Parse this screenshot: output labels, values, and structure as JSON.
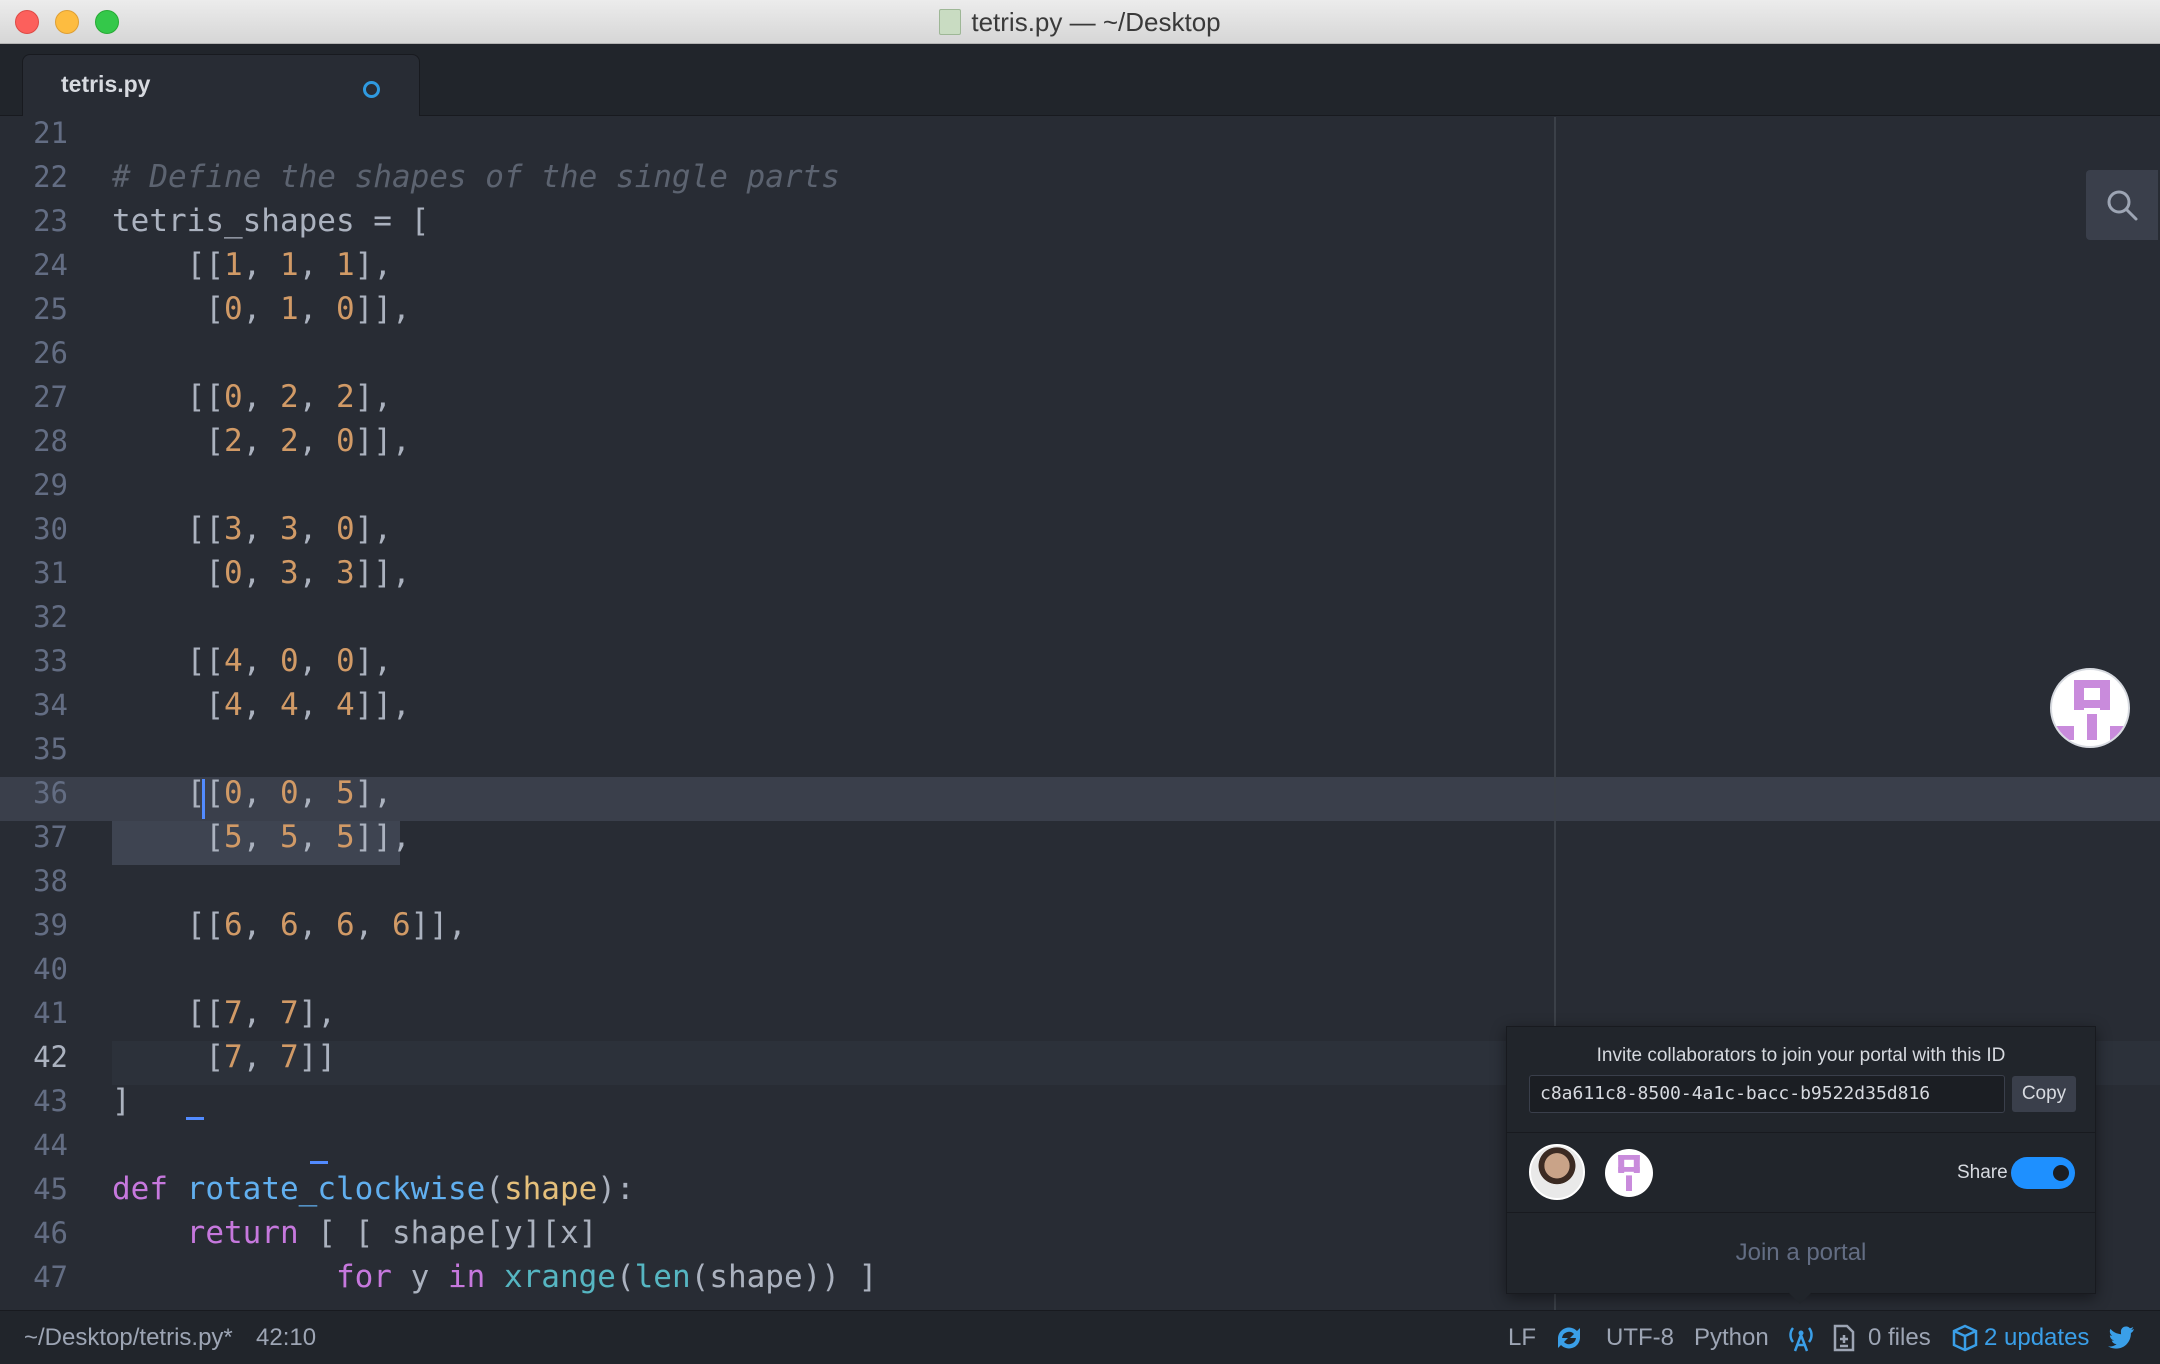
{
  "window": {
    "title": "tetris.py — ~/Desktop"
  },
  "tabs": [
    {
      "label": "tetris.py",
      "modified": true
    }
  ],
  "editor": {
    "first_line_number": 21,
    "current_line": 42,
    "lines": [
      {
        "n": "21",
        "code": ""
      },
      {
        "n": "22",
        "code": "# Define the shapes of the single parts"
      },
      {
        "n": "23",
        "code": "tetris_shapes = ["
      },
      {
        "n": "24",
        "code": "    [[1, 1, 1],"
      },
      {
        "n": "25",
        "code": "     [0, 1, 0]],"
      },
      {
        "n": "26",
        "code": ""
      },
      {
        "n": "27",
        "code": "    [[0, 2, 2],"
      },
      {
        "n": "28",
        "code": "     [2, 2, 0]],"
      },
      {
        "n": "29",
        "code": ""
      },
      {
        "n": "30",
        "code": "    [[3, 3, 0],"
      },
      {
        "n": "31",
        "code": "     [0, 3, 3]],"
      },
      {
        "n": "32",
        "code": ""
      },
      {
        "n": "33",
        "code": "    [[4, 0, 0],"
      },
      {
        "n": "34",
        "code": "     [4, 4, 4]],"
      },
      {
        "n": "35",
        "code": ""
      },
      {
        "n": "36",
        "code": "    [[0, 0, 5],"
      },
      {
        "n": "37",
        "code": "     [5, 5, 5]],"
      },
      {
        "n": "38",
        "code": ""
      },
      {
        "n": "39",
        "code": "    [[6, 6, 6, 6]],"
      },
      {
        "n": "40",
        "code": ""
      },
      {
        "n": "41",
        "code": "    [[7, 7],"
      },
      {
        "n": "42",
        "code": "     [7, 7]]"
      },
      {
        "n": "43",
        "code": "]"
      },
      {
        "n": "44",
        "code": ""
      },
      {
        "n": "45",
        "code": "def rotate_clockwise(shape):"
      },
      {
        "n": "46",
        "code": "    return [ [ shape[y][x]"
      },
      {
        "n": "47",
        "code": "            for y in xrange(len(shape)) ]"
      }
    ]
  },
  "portal_popover": {
    "invite_text": "Invite collaborators to join your portal with this ID",
    "portal_id": "c8a611c8-8500-4a1c-bacc-b9522d35d816",
    "copy_label": "Copy",
    "share_label": "Share",
    "share_enabled": true,
    "join_label": "Join a portal"
  },
  "status_bar": {
    "file_path": "~/Desktop/tetris.py*",
    "cursor_position": "42:10",
    "line_ending": "LF",
    "encoding": "UTF-8",
    "grammar": "Python",
    "github_files": "0 files",
    "updates": "2 updates"
  },
  "colors": {
    "accent_blue": "#3a9fe8",
    "toggle_on": "#1e90ff",
    "editor_bg": "#282c34"
  },
  "icons": {
    "find": "search-icon",
    "portal_host": "teletype-portal-avatar",
    "sync": "sync-icon",
    "broadcast": "broadcast-icon",
    "diff": "file-diff-icon",
    "package": "package-icon",
    "bird": "twitter-bird-icon"
  }
}
